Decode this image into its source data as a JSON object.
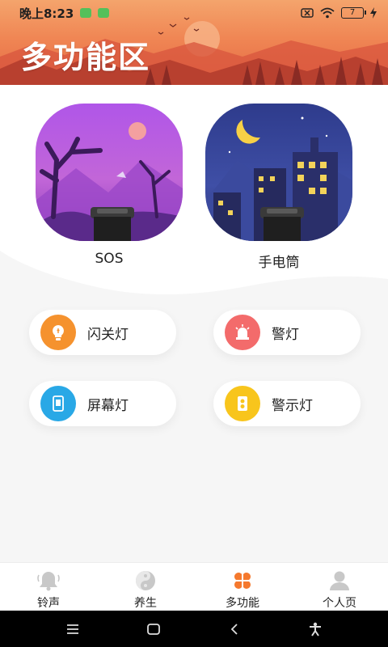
{
  "status_bar": {
    "time": "晚上8:23",
    "battery": "7"
  },
  "header": {
    "title": "多功能区"
  },
  "features": [
    {
      "label": "SOS"
    },
    {
      "label": "手电筒"
    }
  ],
  "tools": [
    {
      "label": "闪关灯",
      "icon": "lightbulb-icon",
      "color": "#f5922e"
    },
    {
      "label": "警灯",
      "icon": "siren-icon",
      "color": "#f36b6b"
    },
    {
      "label": "屏幕灯",
      "icon": "screen-icon",
      "color": "#29a8e6"
    },
    {
      "label": "警示灯",
      "icon": "warning-light-icon",
      "color": "#f8c51c"
    }
  ],
  "bottom_nav": [
    {
      "label": "铃声",
      "icon": "bell-icon",
      "active": false
    },
    {
      "label": "养生",
      "icon": "yin-yang-icon",
      "active": false
    },
    {
      "label": "多功能",
      "icon": "clover-icon",
      "active": true
    },
    {
      "label": "个人页",
      "icon": "person-icon",
      "active": false
    }
  ],
  "colors": {
    "accent": "#f5792e",
    "inactive_icon": "#c8c8c8"
  }
}
